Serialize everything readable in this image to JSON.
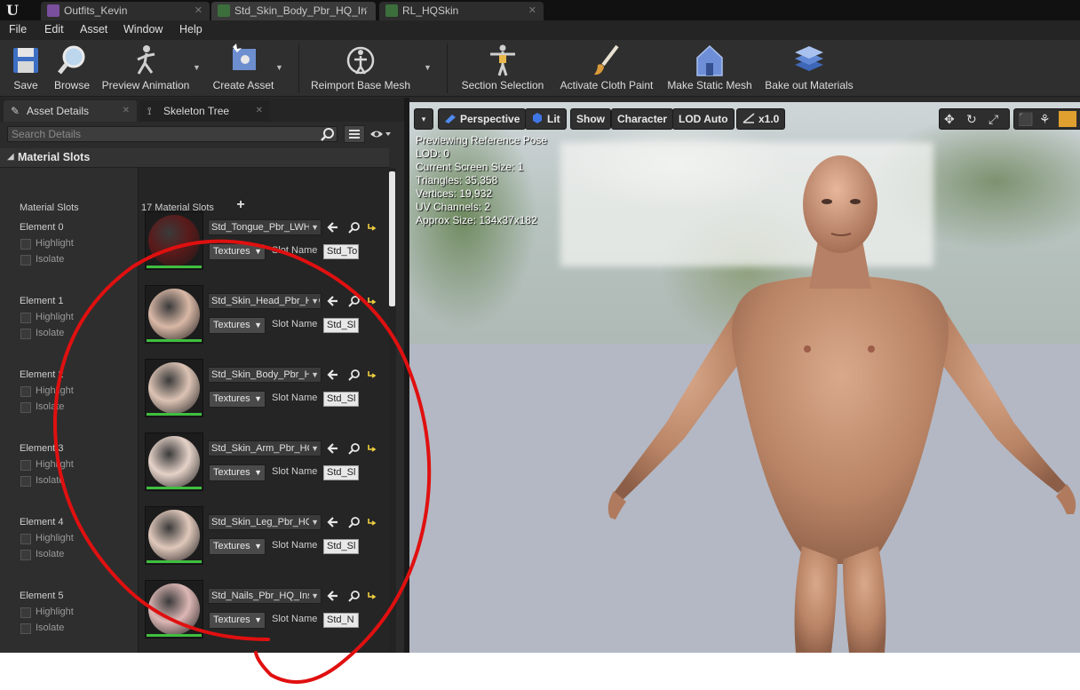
{
  "document_tabs": [
    {
      "label": "Outfits_Kevin",
      "close": "✕"
    },
    {
      "label": "Std_Skin_Body_Pbr_HQ_In",
      "close": "✕"
    },
    {
      "label": "RL_HQSkin",
      "close": "✕"
    }
  ],
  "menu": [
    "File",
    "Edit",
    "Asset",
    "Window",
    "Help"
  ],
  "toolbar": {
    "save": "Save",
    "browse": "Browse",
    "preview_animation": "Preview Animation",
    "create_asset": "Create Asset",
    "reimport_base_mesh": "Reimport Base Mesh",
    "section_selection": "Section Selection",
    "activate_cloth_paint": "Activate Cloth Paint",
    "make_static_mesh": "Make Static Mesh",
    "bake_out_materials": "Bake out Materials"
  },
  "panel_tabs": {
    "asset_details": "Asset Details",
    "skeleton_tree": "Skeleton Tree",
    "close": "✕"
  },
  "details": {
    "search_placeholder": "Search Details",
    "category": "Material Slots",
    "material_slots_label": "Material Slots",
    "material_slots_count": "17 Material Slots",
    "add_symbol": "+",
    "highlight_label": "Highlight",
    "isolate_label": "Isolate",
    "textures_label": "Textures",
    "slot_name_label": "Slot Name",
    "elements": [
      {
        "label": "Element 0",
        "material": "Std_Tongue_Pbr_LWHQ",
        "slot_name": "Std_To",
        "thumb_color": "#5a1a1a"
      },
      {
        "label": "Element 1",
        "material": "Std_Skin_Head_Pbr_HQ",
        "slot_name": "Std_Sl",
        "thumb_color": "#d9b8a6"
      },
      {
        "label": "Element 2",
        "material": "Std_Skin_Body_Pbr_HQ",
        "slot_name": "Std_Sl",
        "thumb_color": "#dcc3b4"
      },
      {
        "label": "Element 3",
        "material": "Std_Skin_Arm_Pbr_HQ",
        "slot_name": "Std_Sl",
        "thumb_color": "#e5d2c8"
      },
      {
        "label": "Element 4",
        "material": "Std_Skin_Leg_Pbr_HQ_",
        "slot_name": "Std_Sl",
        "thumb_color": "#e0c8bb"
      },
      {
        "label": "Element 5",
        "material": "Std_Nails_Pbr_HQ_Ins",
        "slot_name": "Std_N",
        "thumb_color": "#dcb7b5"
      }
    ]
  },
  "viewport": {
    "menu_arrow": "▾",
    "perspective": "Perspective",
    "lit": "Lit",
    "show": "Show",
    "character": "Character",
    "lod": "LOD Auto",
    "speed": "x1.0",
    "stats": [
      "Previewing Reference Pose",
      "LOD: 0",
      "Current Screen Size: 1",
      "Triangles: 35,358",
      "Vertices: 19,932",
      "UV Channels: 2",
      "Approx Size: 134x37x182"
    ]
  },
  "colors": {
    "accent_blue": "#2f6fe0",
    "selection_green": "#3fbf3f",
    "annotation_red": "#e01010",
    "tab_icon_purple": "#7a4f9c",
    "tab_icon_green": "#3c6e3c"
  }
}
